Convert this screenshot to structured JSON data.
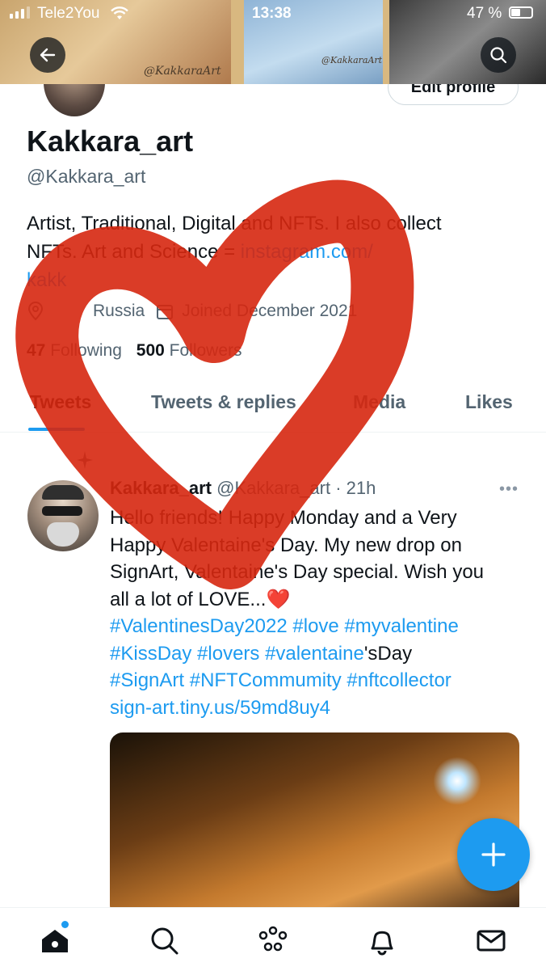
{
  "status_bar": {
    "carrier": "Tele2You",
    "time": "13:38",
    "battery": "47 %"
  },
  "banner": {
    "signature_1": "@KakkaraArt",
    "signature_2": "@KakkaraArt"
  },
  "header": {
    "back_icon": "arrow-left-icon",
    "search_icon": "search-icon"
  },
  "profile": {
    "edit_button": "Edit profile",
    "display_name": "Kakkara_art",
    "handle": "@Kakkara_art",
    "bio_line1": "Artist, Traditional, Digital and NFTs. I also collect",
    "bio_line2_prefix": "NFTs. Art and Science = ",
    "bio_link": "instagram.com/",
    "bio_line3": "kakk",
    "location": "Russia",
    "joined": "Joined December 2021",
    "following_count": "47",
    "following_label": "Following",
    "followers_count": "500",
    "followers_label": "Followers"
  },
  "tabs": [
    {
      "label": "Tweets",
      "active": true
    },
    {
      "label": "Tweets & replies"
    },
    {
      "label": "Media"
    },
    {
      "label": "Likes"
    }
  ],
  "tweet": {
    "name": "Kakkara_art",
    "handle": "@Kakkara_art",
    "dot": "·",
    "time": "21h",
    "more": "•••",
    "text_line1": "Hello friends! Happy Monday and a Very",
    "text_line2": "Happy Valentaine's Day. My new drop on",
    "text_line3": "SignArt, Valentaine's Day special. Wish you",
    "text_line4": "all a lot of LOVE...",
    "emoji": "❤️",
    "hashtags_line1": "#ValentinesDay2022 #love #myvalentine",
    "hashtags_line2_a": "#KissDay #lovers #valentaine",
    "hashtags_line2_b": "'sDay",
    "hashtags_line3": "#SignArt #NFTCommumity #nftcollector",
    "link": "sign-art.tiny.us/59md8uy4"
  },
  "colors": {
    "accent": "#1d9bf0",
    "heart": "#d6270f",
    "text": "#0f1419",
    "secondary": "#536471"
  }
}
